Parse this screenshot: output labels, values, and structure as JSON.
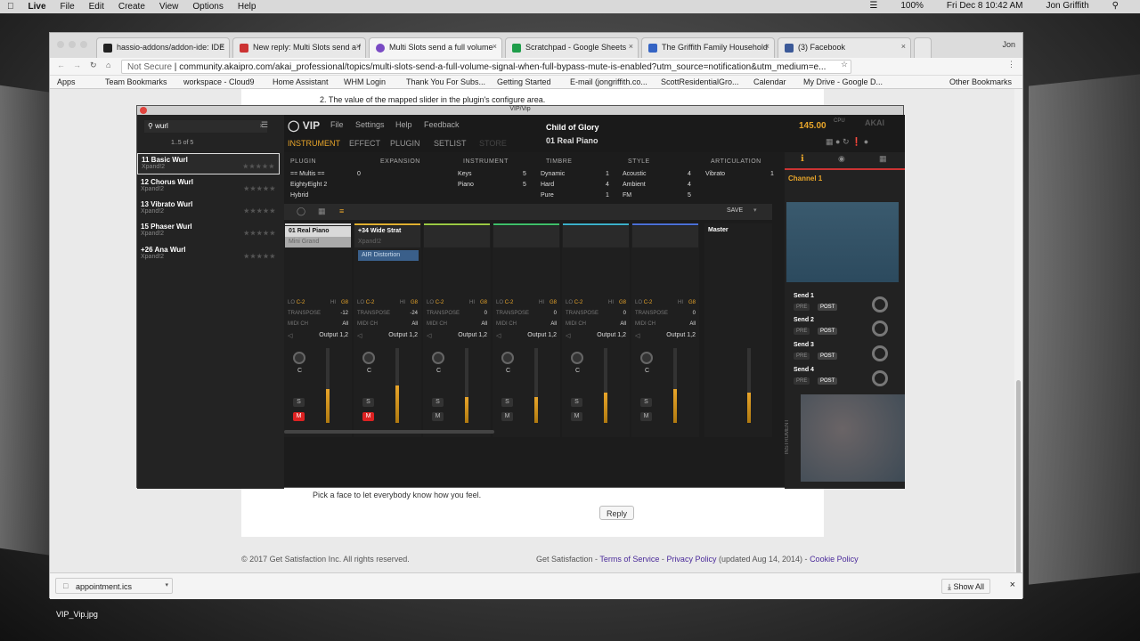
{
  "menubar": {
    "app": "Live",
    "items": [
      "File",
      "Edit",
      "Create",
      "View",
      "Options",
      "Help"
    ],
    "battery": "100%",
    "datetime": "Fri Dec 8  10:42 AM",
    "user": "Jon Griffith"
  },
  "browser": {
    "tabs": [
      {
        "label": "hassio-addons/addon-ide: IDE",
        "color": "#222"
      },
      {
        "label": "New reply: Multi Slots send a f",
        "color": "#c33"
      },
      {
        "label": "Multi Slots send a full volume",
        "color": "#7a4bc4"
      },
      {
        "label": "Scratchpad - Google Sheets",
        "color": "#1e9d4a"
      },
      {
        "label": "The Griffith Family Household",
        "color": "#3564c4"
      },
      {
        "label": "(3) Facebook",
        "color": "#3b5998"
      }
    ],
    "profile": "Jon",
    "url_prefix": "Not Secure",
    "url": "community.akaipro.com/akai_professional/topics/multi-slots-send-a-full-volume-signal-when-full-bypass-mute-is-enabled?utm_source=notification&utm_medium=e...",
    "bookmarks": [
      "Apps",
      "Team Bookmarks",
      "workspace - Cloud9",
      "Home Assistant",
      "WHM Login",
      "Thank You For Subs...",
      "Getting Started",
      "E-mail (jongriffith.co...",
      "ScottResidentialGro...",
      "Calendar",
      "My Drive - Google D..."
    ],
    "other_bookmarks": "Other Bookmarks"
  },
  "page": {
    "line": "2. The value of the mapped slider in the plugin's configure area.",
    "face_prompt": "Pick a face to let everybody know how you feel.",
    "reply": "Reply",
    "copyright": "© 2017 Get Satisfaction Inc. All rights reserved.",
    "footer_brand": "Get Satisfaction -",
    "footer_terms": "Terms of Service",
    "footer_sep": "-",
    "footer_privacy": "Privacy Policy",
    "footer_updated": "(updated Aug 14, 2014) -",
    "footer_cookie": "Cookie Policy"
  },
  "download": {
    "file": "appointment.ics",
    "show_all": "Show All"
  },
  "desktop": {
    "file": "VIP_Vip.jpg"
  },
  "vip": {
    "title": "VIP/Vip",
    "search": "wurl",
    "count": "1..5 of 5",
    "presets": [
      {
        "name": "11 Basic Wurl",
        "sub": "Xpand!2"
      },
      {
        "name": "12 Chorus Wurl",
        "sub": "Xpand!2"
      },
      {
        "name": "13 Vibrato Wurl",
        "sub": "Xpand!2"
      },
      {
        "name": "15 Phaser Wurl",
        "sub": "Xpand!2"
      },
      {
        "name": "+26 Ana Wurl",
        "sub": "Xpand!2"
      }
    ],
    "menu": [
      "File",
      "Settings",
      "Help",
      "Feedback"
    ],
    "tabs": [
      "INSTRUMENT",
      "EFFECT",
      "PLUGIN",
      "SETLIST",
      "STORE"
    ],
    "song": "Child of Glory",
    "patch": "01 Real Piano",
    "tempo": "145.00",
    "cpu": "CPU",
    "categories": {
      "headers": [
        "PLUGIN",
        "EXPANSION",
        "INSTRUMENT",
        "TIMBRE",
        "STYLE",
        "ARTICULATION"
      ],
      "plugin": [
        "== Multis ==",
        "EightyEight 2",
        "Hybrid"
      ],
      "plugin_count": "0",
      "instrument": [
        [
          "Keys",
          "5"
        ],
        [
          "Piano",
          "5"
        ]
      ],
      "timbre": [
        [
          "Dynamic",
          "1"
        ],
        [
          "Hard",
          "4"
        ],
        [
          "Pure",
          "1"
        ]
      ],
      "style": [
        [
          "Acoustic",
          "4"
        ],
        [
          "Ambient",
          "4"
        ],
        [
          "FM",
          "5"
        ]
      ],
      "articulation": [
        [
          "Vibrato",
          "1"
        ]
      ]
    },
    "save": "SAVE",
    "strips": [
      {
        "slot": "01 Real Piano",
        "sub": "Mini Grand",
        "fx": "",
        "transpose": "-12",
        "midi": "All",
        "out": "Output 1,2",
        "level": 0.45,
        "mute": true,
        "color": "#d9d9d9"
      },
      {
        "slot": "+34 Wide Strat",
        "sub": "Xpand!2",
        "fx": "AIR Distortion",
        "transpose": "-24",
        "midi": "All",
        "out": "Output 1,2",
        "level": 0.5,
        "mute": true,
        "color": "#e0b030"
      },
      {
        "slot": "",
        "sub": "",
        "fx": "",
        "transpose": "0",
        "midi": "All",
        "out": "Output 1,2",
        "level": 0.35,
        "mute": false,
        "color": "#9ac943"
      },
      {
        "slot": "",
        "sub": "",
        "fx": "",
        "transpose": "0",
        "midi": "All",
        "out": "Output 1,2",
        "level": 0.35,
        "mute": false,
        "color": "#3ebf6a"
      },
      {
        "slot": "",
        "sub": "",
        "fx": "",
        "transpose": "0",
        "midi": "All",
        "out": "Output 1,2",
        "level": 0.4,
        "mute": false,
        "color": "#3bb0c9"
      },
      {
        "slot": "",
        "sub": "",
        "fx": "",
        "transpose": "0",
        "midi": "All",
        "out": "Output 1,2",
        "level": 0.45,
        "mute": false,
        "color": "#4a6fd6"
      }
    ],
    "master": "Master",
    "lo": "LO",
    "hi": "HI",
    "lo_val": "C-2",
    "hi_val": "G8",
    "transpose_label": "TRANSPOSE",
    "midi_label": "MIDI CH",
    "knob_label": "C",
    "solo": "S",
    "mute": "M",
    "channel": "Channel 1",
    "sends": [
      "Send 1",
      "Send 2",
      "Send 3",
      "Send 4"
    ],
    "pre": "PRE",
    "post": "POST",
    "instrument_vert": "INSTRUMENT"
  }
}
